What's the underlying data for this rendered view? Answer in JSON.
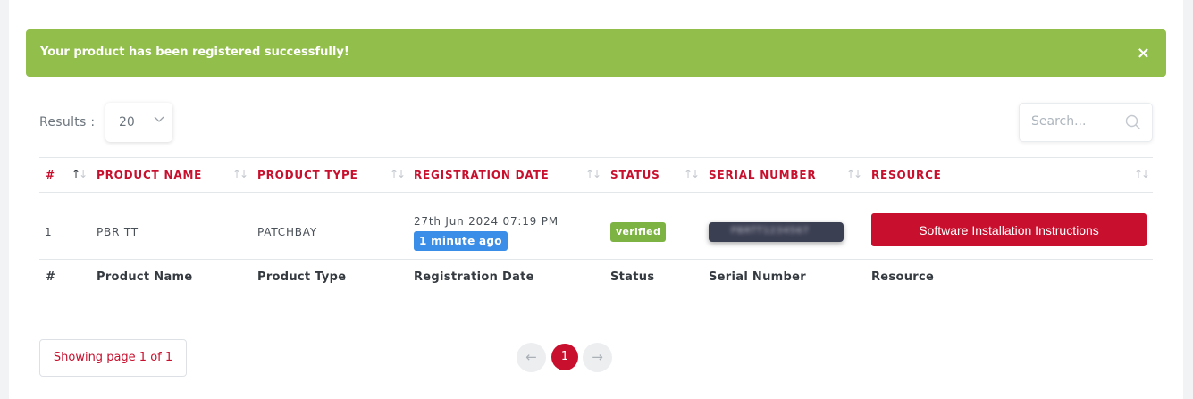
{
  "alert": {
    "message": "Your product has been registered successfully!",
    "close_glyph": "×"
  },
  "results": {
    "label": "Results :",
    "page_size": "20"
  },
  "search": {
    "placeholder": "Search..."
  },
  "table": {
    "headers": [
      "#",
      "PRODUCT NAME",
      "PRODUCT TYPE",
      "REGISTRATION DATE",
      "STATUS",
      "SERIAL NUMBER",
      "RESOURCE"
    ],
    "footers": [
      "#",
      "Product Name",
      "Product Type",
      "Registration Date",
      "Status",
      "Serial Number",
      "Resource"
    ],
    "rows": [
      {
        "index": "1",
        "product_name": "PBR TT",
        "product_type": "PATCHBAY",
        "registration_date": "27th Jun 2024 07:19 PM",
        "relative_time": "1 minute ago",
        "status": "verified",
        "serial_number": "PBRTT1234567",
        "resource_label": "Software Installation Instructions"
      }
    ]
  },
  "pagination": {
    "info": "Showing page 1 of 1",
    "prev_glyph": "←",
    "current_page": "1",
    "next_glyph": "→"
  },
  "colors": {
    "brand": "#c8102e",
    "success": "#92be4b",
    "info": "#3b8ee8"
  }
}
